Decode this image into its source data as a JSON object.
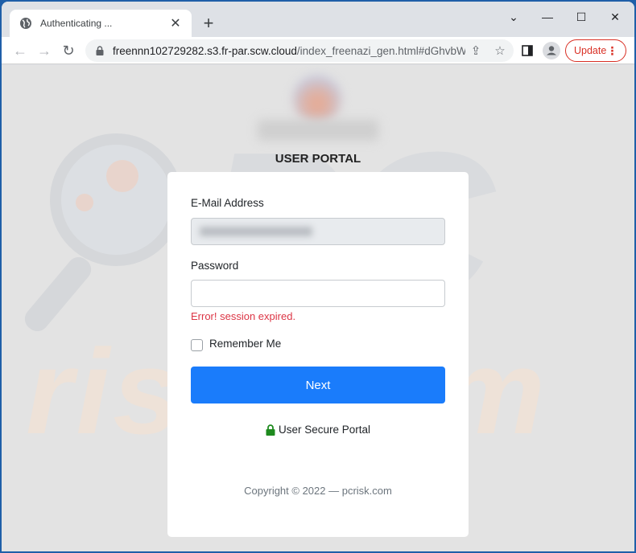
{
  "browser": {
    "tab": {
      "title": "Authenticating ...",
      "icon": "globe-icon"
    },
    "new_tab_label": "+",
    "window_controls": {
      "tab_search": "⌄",
      "minimize": "—",
      "maximize": "☐",
      "close": "✕"
    },
    "address_bar": {
      "url_host": "freennn102729282.s3.fr-par.scw.cloud",
      "url_path": "/index_freenazi_gen.html#dGhvbW..."
    },
    "update_label": "Update"
  },
  "page": {
    "portal_title": "USER PORTAL",
    "form": {
      "email_label": "E-Mail Address",
      "email_value": "",
      "password_label": "Password",
      "password_value": "",
      "error_message": "Error! session expired.",
      "remember_label": "Remember Me",
      "remember_checked": false,
      "next_label": "Next"
    },
    "secure_label": "User Secure Portal",
    "copyright": "Copyright © 2022 — pcrisk.com",
    "colors": {
      "primary": "#1a7cfb",
      "error": "#dc3545",
      "lock": "#1e8a1e",
      "update": "#d93025"
    }
  }
}
